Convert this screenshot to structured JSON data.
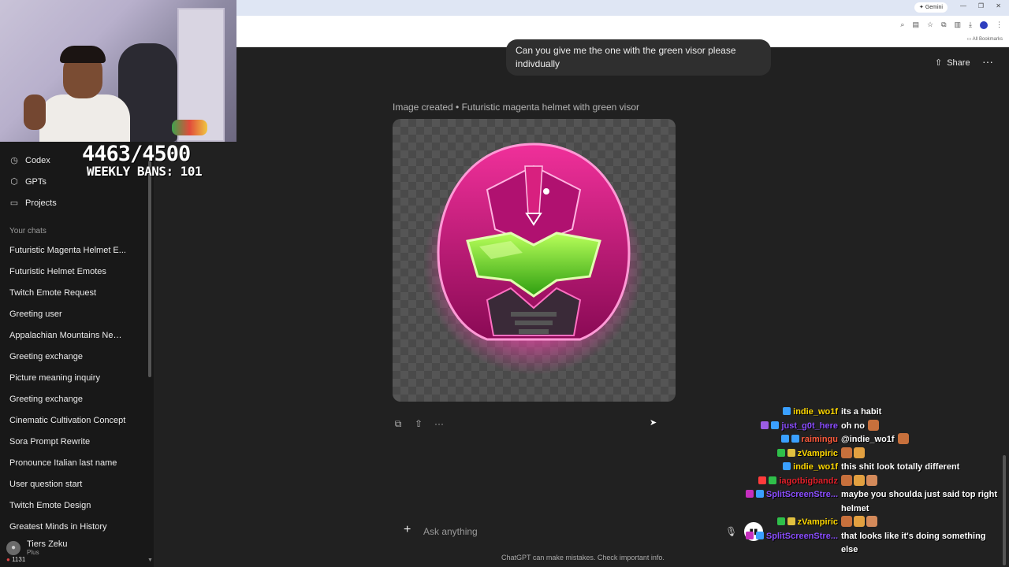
{
  "browser": {
    "gemini_label": "Gemini",
    "bookmarks_label": "All Bookmarks"
  },
  "overlay": {
    "counter": "4463/4500",
    "weekly_bans": "WEEKLY BANS: 101"
  },
  "sidebar": {
    "nav": [
      {
        "label": "Codex",
        "icon": "codex-icon"
      },
      {
        "label": "GPTs",
        "icon": "gpts-icon"
      },
      {
        "label": "Projects",
        "icon": "projects-icon"
      }
    ],
    "section_label": "Your chats",
    "chats": [
      "Futuristic Magenta Helmet E...",
      "Futuristic Helmet Emotes",
      "Twitch Emote Request",
      "Greeting user",
      "Appalachian Mountains Neph...",
      "Greeting exchange",
      "Picture meaning inquiry",
      "Greeting exchange",
      "Cinematic Cultivation Concept",
      "Sora Prompt Rewrite",
      "Pronounce Italian last name",
      "User question start",
      "Twitch Emote Design",
      "Greatest Minds in History"
    ],
    "user": {
      "name": "Tiers Zeku",
      "plan": "Plus"
    },
    "viewer_count": "1131"
  },
  "main": {
    "previous_message": "Can you give me the one with the green visor please indivdually",
    "share_label": "Share",
    "image_caption": "Image created • Futuristic magenta helmet with green visor",
    "composer_placeholder": "Ask anything",
    "disclaimer": "ChatGPT can make mistakes. Check important info."
  },
  "twitch_chat": [
    {
      "user": "indie_wo1f",
      "color": "#ffd800",
      "text": "its a habit",
      "badges": [
        "#3aa0ff"
      ],
      "emotes": 0
    },
    {
      "user": "just_g0t_here",
      "color": "#8a4dff",
      "text": "oh no",
      "badges": [
        "#9b5de5",
        "#3aa0ff"
      ],
      "emotes": 1
    },
    {
      "user": "raimingu",
      "color": "#ff5a3c",
      "text": "@indie_wo1f",
      "badges": [
        "#3aa0ff",
        "#3aa0ff"
      ],
      "emotes": 1
    },
    {
      "user": "zVampiric",
      "color": "#ffd800",
      "text": "",
      "badges": [
        "#2fbf4a",
        "#e0c040"
      ],
      "emotes": 2
    },
    {
      "user": "indie_wo1f",
      "color": "#ffd800",
      "text": "this shit look totally different",
      "badges": [
        "#3aa0ff"
      ],
      "emotes": 0
    },
    {
      "user": "iagotbigbandz",
      "color": "#e0202a",
      "text": "",
      "badges": [
        "#ff3b3b",
        "#2fbf4a"
      ],
      "emotes": 3
    },
    {
      "user": "SplitScreenStre...",
      "color": "#8a4dff",
      "text": "maybe you shoulda just said top right helmet",
      "badges": [
        "#c62fbf",
        "#3aa0ff"
      ],
      "emotes": 0
    },
    {
      "user": "zVampiric",
      "color": "#ffd800",
      "text": "",
      "badges": [
        "#2fbf4a",
        "#e0c040"
      ],
      "emotes": 3
    },
    {
      "user": "SplitScreenStre...",
      "color": "#8a4dff",
      "text": "that looks like it's doing something else",
      "badges": [
        "#c62fbf",
        "#3aa0ff"
      ],
      "emotes": 0
    }
  ],
  "colors": {
    "helmet_magenta": "#d0117a",
    "visor_green": "#58e02a",
    "background": "#212121",
    "sidebar": "#181818"
  }
}
